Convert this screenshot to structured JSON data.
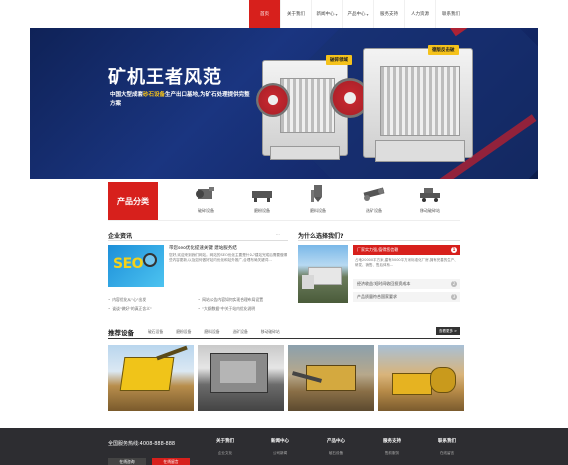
{
  "nav": {
    "items": [
      {
        "label": "首页",
        "active": true
      },
      {
        "label": "关于我们"
      },
      {
        "label": "新闻中心",
        "caret": "▾"
      },
      {
        "label": "产品中心",
        "caret": "▾"
      },
      {
        "label": "服务支持"
      },
      {
        "label": "人力资源"
      },
      {
        "label": "联系我们"
      }
    ]
  },
  "banner": {
    "title": "矿机王者风范",
    "subtitle_pre": "中国大型成套",
    "subtitle_highlight": "砂石设备",
    "subtitle_post": "生产出口基地,为矿石处理提供完整方案",
    "tag_left": "破碎领域",
    "tag_right": "德版反击破"
  },
  "categories": {
    "heading": "产品分类",
    "items": [
      {
        "label": "破碎设备",
        "icon": "crusher-icon"
      },
      {
        "label": "磨粉设备",
        "icon": "mill-icon"
      },
      {
        "label": "磨料设备",
        "icon": "silo-icon"
      },
      {
        "label": "选矿设备",
        "icon": "rotary-kiln-icon"
      },
      {
        "label": "移动破碎站",
        "icon": "mobile-station-icon"
      }
    ]
  },
  "news": {
    "title": "企业资讯",
    "more": "···",
    "featured_title": "带您seo优化提速关键 建站服务结",
    "featured_body": "您好,欢迎来到我们网站。网站的SEO优化主要是什么?建站完成后需要做哪些内容更新,以及如何做好站内优化和站外推广,合理布局关键词...",
    "rows": [
      [
        "内容优化从\"心\"出发",
        "网站公告内容如何实现合理布局设置"
      ],
      [
        "谈谈\"做好\"的真正含义\"",
        "\"大纲数据\"中关于站内优化说明"
      ]
    ]
  },
  "why": {
    "title": "为什么选择我们?",
    "head_label": "厂家实力强,值得您信赖",
    "head_badge": "1",
    "desc": "占地20000平方米,建有5000平方米标准化厂房,拥有完善的生产、研发、销售、售后体系...",
    "rows": [
      {
        "label": "经济收益:短时间收回投资成本",
        "badge": "2"
      },
      {
        "label": "产品质量符合国家要求",
        "badge": "3"
      }
    ]
  },
  "recommended": {
    "title": "推荐设备",
    "tabs": [
      "破石设备",
      "磨粉设备",
      "磨料设备",
      "选矿设备",
      "移动破碎站"
    ],
    "more": "查看更多 >"
  },
  "footer": {
    "hotline": "全国服务热线:4008-888-888",
    "btn_online": "在线咨询",
    "btn_message": "在线留言",
    "columns": [
      {
        "heading": "关于我们",
        "link": "企业文化"
      },
      {
        "heading": "新闻中心",
        "link": "公司新闻"
      },
      {
        "heading": "产品中心",
        "link": "破石设备"
      },
      {
        "heading": "服务支持",
        "link": "售前服务"
      },
      {
        "heading": "联系我们",
        "link": "在线留言"
      }
    ]
  },
  "colors": {
    "accent": "#d7201c",
    "banner_bg": "#14296b",
    "highlight": "#f5c21b",
    "footer_bg": "#2d2d31"
  }
}
